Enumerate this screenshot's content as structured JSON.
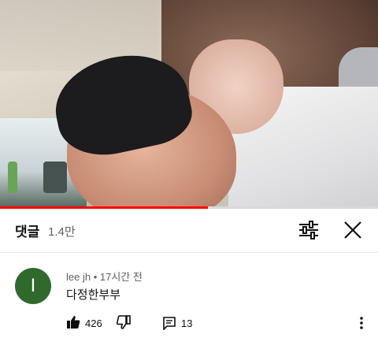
{
  "video": {
    "progress_fraction": 0.55,
    "progress_color": "#ff0000"
  },
  "comments_panel": {
    "title": "댓글",
    "count": "1.4만",
    "sort_icon": "sort-icon",
    "close_icon": "close-icon"
  },
  "comment": {
    "avatar_letter": "I",
    "avatar_color": "#2f6a2c",
    "meta": "lee jh • 17시간 전",
    "text": "다정한부부",
    "like_count": "426",
    "reply_count": "13",
    "icons": [
      "like-icon",
      "dislike-icon",
      "reply-icon",
      "more-vert-icon"
    ]
  }
}
